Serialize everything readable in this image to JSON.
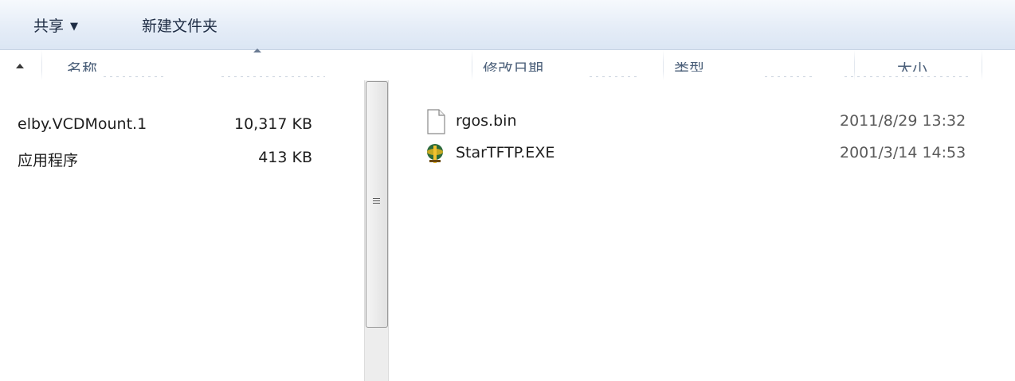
{
  "toolbar": {
    "share_label": "共享",
    "share_caret": "▼",
    "new_folder_label": "新建文件夹"
  },
  "columns": {
    "name": "名称",
    "modified": "修改日期",
    "type": "类型",
    "size": "大小"
  },
  "left_panel": {
    "rows": [
      {
        "name": "elby.VCDMount.1",
        "size": "10,317 KB"
      },
      {
        "name": "应用程序",
        "size": "413 KB"
      }
    ]
  },
  "files": [
    {
      "name": "rgos.bin",
      "modified": "2011/8/29 13:32",
      "icon": "blank-file-icon"
    },
    {
      "name": "StarTFTP.EXE",
      "modified": "2001/3/14 14:53",
      "icon": "startftp-app-icon"
    }
  ],
  "colors": {
    "toolbar_bg": "#dbe6f4",
    "header_text": "#4c607a",
    "date_text": "#5a5a5a"
  }
}
